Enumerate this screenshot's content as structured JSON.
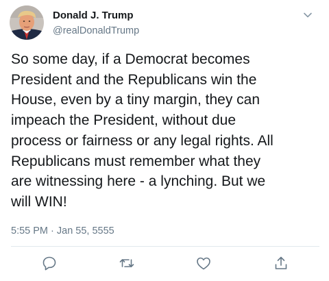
{
  "tweet": {
    "author": {
      "display_name": "Donald J. Trump",
      "handle": "@realDonaldTrump",
      "avatar_icon": "profile-photo"
    },
    "text": "So some day, if a Democrat becomes\nPresident and the Republicans win the\nHouse, even by a tiny margin, they can\nimpeach the President, without due\nprocess or fairness or any legal rights. All\nRepublicans must remember what they\nare witnessing here - a lynching. But we\nwill WIN!",
    "timestamp": "5:55 PM · Jan 55, 5555",
    "menu_icon": "chevron-down-icon",
    "actions": [
      {
        "name": "reply",
        "icon": "reply-icon"
      },
      {
        "name": "retweet",
        "icon": "retweet-icon"
      },
      {
        "name": "like",
        "icon": "heart-icon"
      },
      {
        "name": "share",
        "icon": "share-icon"
      }
    ]
  },
  "colors": {
    "text_primary": "#14171a",
    "text_secondary": "#657786",
    "icon_gray": "#657786",
    "divider": "#e1e8ed",
    "background": "#ffffff"
  }
}
